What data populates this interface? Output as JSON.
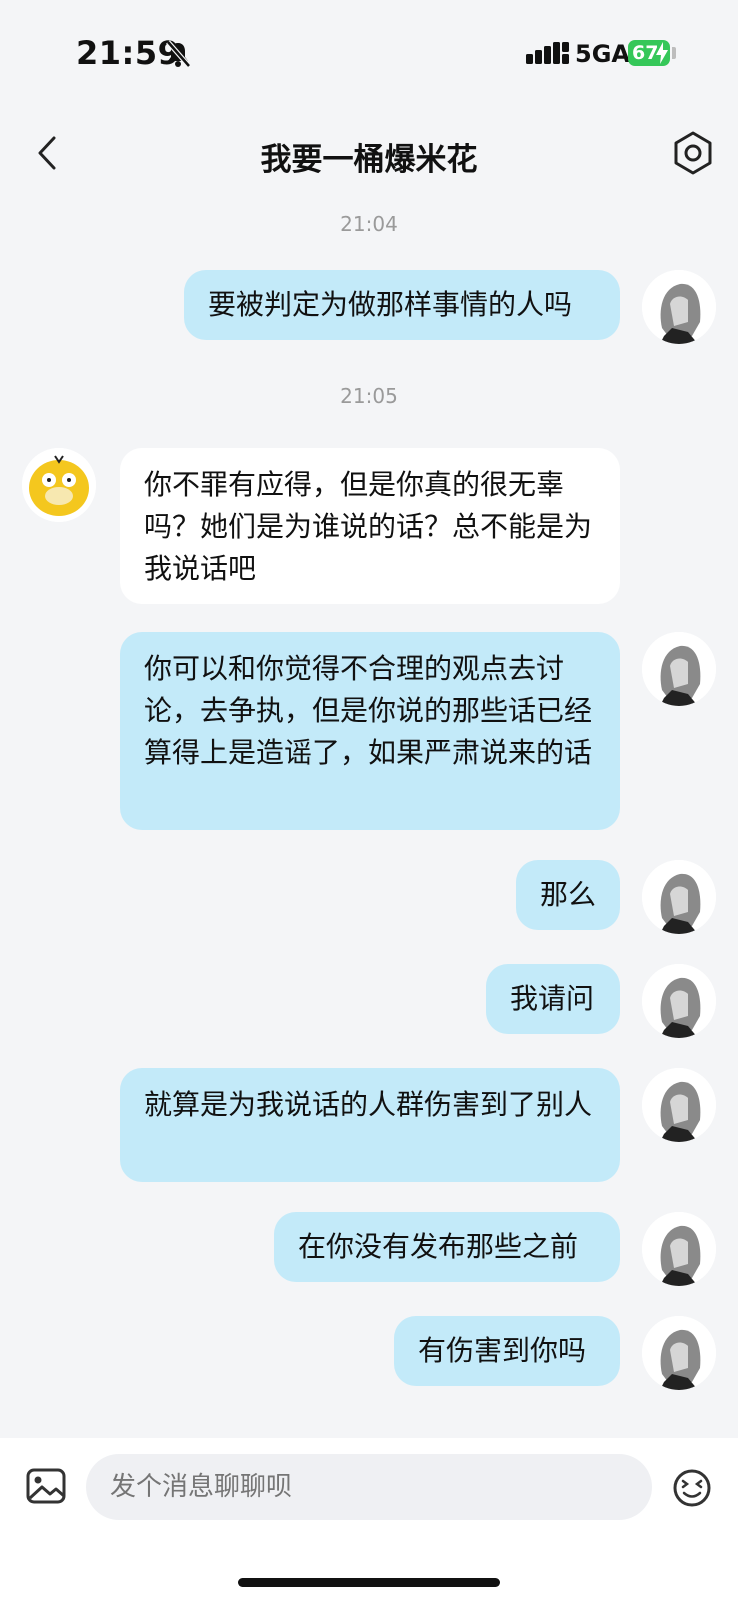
{
  "status": {
    "time": "21:59",
    "network": "5GA",
    "battery": "67"
  },
  "header": {
    "title": "我要一桶爆米花"
  },
  "messages": [
    {
      "type": "time",
      "text": "21:04"
    },
    {
      "type": "me",
      "text": "要被判定为做那样事情的人吗"
    },
    {
      "type": "time",
      "text": "21:05"
    },
    {
      "type": "other",
      "text": "你不罪有应得，但是你真的很无辜吗？她们是为谁说的话？总不能是为我说话吧"
    },
    {
      "type": "me",
      "text": "你可以和你觉得不合理的观点去讨论，去争执，但是你说的那些话已经算得上是造谣了，如果严肃说来的话"
    },
    {
      "type": "me",
      "text": "那么"
    },
    {
      "type": "me",
      "text": "我请问"
    },
    {
      "type": "me",
      "text": "就算是为我说话的人群伤害到了别人"
    },
    {
      "type": "me",
      "text": "在你没有发布那些之前"
    },
    {
      "type": "me",
      "text": "有伤害到你吗"
    }
  ],
  "input": {
    "placeholder": "发个消息聊聊呗"
  }
}
